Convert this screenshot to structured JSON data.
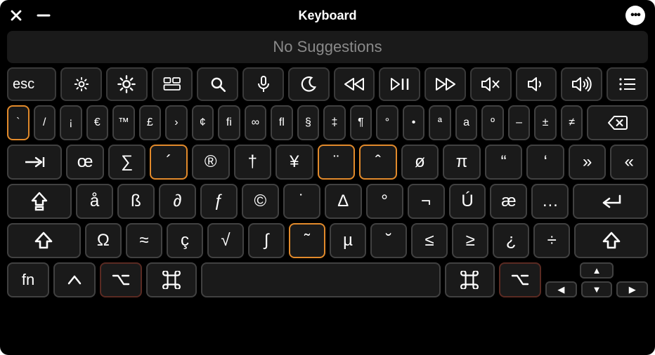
{
  "window": {
    "title": "Keyboard"
  },
  "suggestions": {
    "text": "No Suggestions"
  },
  "fn_row": [
    {
      "name": "esc-key",
      "label": "esc",
      "icon": null
    },
    {
      "name": "brightness-down-key",
      "label": "",
      "icon": "brightness-low"
    },
    {
      "name": "brightness-up-key",
      "label": "",
      "icon": "brightness-high"
    },
    {
      "name": "mission-control-key",
      "label": "",
      "icon": "mission-control"
    },
    {
      "name": "spotlight-key",
      "label": "",
      "icon": "search"
    },
    {
      "name": "dictation-key",
      "label": "",
      "icon": "mic"
    },
    {
      "name": "do-not-disturb-key",
      "label": "",
      "icon": "moon"
    },
    {
      "name": "rewind-key",
      "label": "",
      "icon": "rewind"
    },
    {
      "name": "play-pause-key",
      "label": "",
      "icon": "playpause"
    },
    {
      "name": "fast-forward-key",
      "label": "",
      "icon": "ffwd"
    },
    {
      "name": "mute-key",
      "label": "",
      "icon": "mute"
    },
    {
      "name": "volume-down-key",
      "label": "",
      "icon": "vol-down"
    },
    {
      "name": "volume-up-key",
      "label": "",
      "icon": "vol-up"
    },
    {
      "name": "list-key",
      "label": "",
      "icon": "list"
    }
  ],
  "row1": [
    {
      "name": "key-grave",
      "label": "`",
      "hl": "orange"
    },
    {
      "name": "key-slash",
      "label": "/"
    },
    {
      "name": "key-inverted-exclaim",
      "label": "¡"
    },
    {
      "name": "key-euro",
      "label": "€"
    },
    {
      "name": "key-trademark",
      "label": "™"
    },
    {
      "name": "key-pound",
      "label": "£"
    },
    {
      "name": "key-angle-right",
      "label": "›"
    },
    {
      "name": "key-cent",
      "label": "¢"
    },
    {
      "name": "key-fi-ligature",
      "label": "ﬁ"
    },
    {
      "name": "key-infinity",
      "label": "∞"
    },
    {
      "name": "key-fl-ligature",
      "label": "ﬂ"
    },
    {
      "name": "key-section",
      "label": "§"
    },
    {
      "name": "key-double-dagger",
      "label": "‡"
    },
    {
      "name": "key-pilcrow",
      "label": "¶"
    },
    {
      "name": "key-ring",
      "label": "°"
    },
    {
      "name": "key-bullet",
      "label": "•"
    },
    {
      "name": "key-ordfem",
      "label": "ª"
    },
    {
      "name": "key-a-super",
      "label": "a"
    },
    {
      "name": "key-ordmasc",
      "label": "º"
    },
    {
      "name": "key-endash",
      "label": "–"
    },
    {
      "name": "key-plusminus",
      "label": "±"
    },
    {
      "name": "key-notequal",
      "label": "≠"
    },
    {
      "name": "key-backspace",
      "label": "",
      "icon": "backspace",
      "wide": "w15"
    }
  ],
  "row2": [
    {
      "name": "key-tab",
      "label": "",
      "icon": "tab",
      "wide": "w15"
    },
    {
      "name": "key-oe",
      "label": "œ"
    },
    {
      "name": "key-sigma",
      "label": "∑"
    },
    {
      "name": "key-acute",
      "label": "´",
      "hl": "orange"
    },
    {
      "name": "key-registered",
      "label": "®"
    },
    {
      "name": "key-dagger",
      "label": "†"
    },
    {
      "name": "key-yen",
      "label": "¥"
    },
    {
      "name": "key-diaeresis",
      "label": "¨",
      "hl": "orange"
    },
    {
      "name": "key-caret",
      "label": "ˆ",
      "hl": "orange"
    },
    {
      "name": "key-oslash",
      "label": "ø"
    },
    {
      "name": "key-pi",
      "label": "π"
    },
    {
      "name": "key-leftdquote",
      "label": "“"
    },
    {
      "name": "key-lsquote",
      "label": "‘"
    },
    {
      "name": "key-guillemet-right",
      "label": "»"
    },
    {
      "name": "key-guillemet-left",
      "label": "«"
    }
  ],
  "row3": [
    {
      "name": "key-capslock",
      "label": "",
      "icon": "capslock",
      "wide": "w175"
    },
    {
      "name": "key-aring",
      "label": "å"
    },
    {
      "name": "key-eszett",
      "label": "ß"
    },
    {
      "name": "key-partial",
      "label": "∂"
    },
    {
      "name": "key-fhook",
      "label": "ƒ"
    },
    {
      "name": "key-copyright",
      "label": "©"
    },
    {
      "name": "key-overdot",
      "label": "˙"
    },
    {
      "name": "key-delta",
      "label": "∆"
    },
    {
      "name": "key-degree2",
      "label": "°"
    },
    {
      "name": "key-not",
      "label": "¬"
    },
    {
      "name": "key-uacute",
      "label": "Ú"
    },
    {
      "name": "key-ae",
      "label": "æ"
    },
    {
      "name": "key-ellipsis",
      "label": "…"
    },
    {
      "name": "key-return",
      "label": "",
      "icon": "return",
      "wide": "w2"
    }
  ],
  "row4": [
    {
      "name": "key-shift-left",
      "label": "",
      "icon": "shift",
      "wide": "w2"
    },
    {
      "name": "key-omega",
      "label": "Ω"
    },
    {
      "name": "key-approx",
      "label": "≈"
    },
    {
      "name": "key-ccedilla",
      "label": "ç"
    },
    {
      "name": "key-sqrt",
      "label": "√"
    },
    {
      "name": "key-integral",
      "label": "∫"
    },
    {
      "name": "key-tilde",
      "label": "˜",
      "hl": "orange"
    },
    {
      "name": "key-mu",
      "label": "µ"
    },
    {
      "name": "key-breve",
      "label": "˘"
    },
    {
      "name": "key-lessequal",
      "label": "≤"
    },
    {
      "name": "key-greaterequal",
      "label": "≥"
    },
    {
      "name": "key-inverted-question",
      "label": "¿"
    },
    {
      "name": "key-divide",
      "label": "÷"
    },
    {
      "name": "key-shift-right",
      "label": "",
      "icon": "shift",
      "wide": "w2"
    }
  ],
  "row5": {
    "fn": "fn",
    "keys": [
      {
        "name": "key-fn",
        "label": "fn"
      },
      {
        "name": "key-control",
        "icon": "control"
      },
      {
        "name": "key-option-left",
        "icon": "option",
        "hl": "darkred"
      },
      {
        "name": "key-command-left",
        "icon": "command"
      },
      {
        "name": "key-space",
        "space": true
      },
      {
        "name": "key-command-right",
        "icon": "command"
      },
      {
        "name": "key-option-right",
        "icon": "option",
        "hl": "darkred"
      }
    ],
    "arrows": {
      "up": "▲",
      "left": "◀",
      "down": "▼",
      "right": "▶"
    }
  }
}
